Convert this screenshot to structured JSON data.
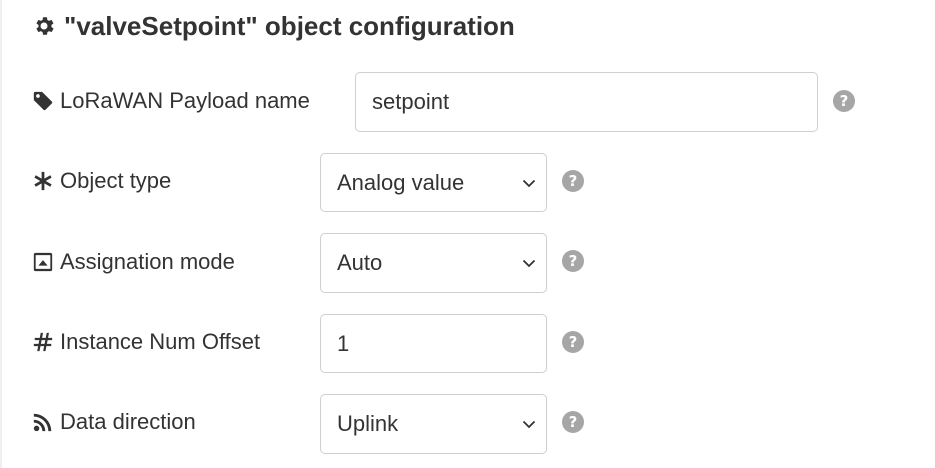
{
  "title": "\"valveSetpoint\" object configuration",
  "fields": {
    "payload_name": {
      "label": "LoRaWAN Payload name",
      "value": "setpoint",
      "icon": "tag-icon"
    },
    "object_type": {
      "label": "Object type",
      "value": "Analog value",
      "icon": "asterisk-icon"
    },
    "assignation_mode": {
      "label": "Assignation mode",
      "value": "Auto",
      "icon": "caret-square-up-icon"
    },
    "instance_offset": {
      "label": "Instance Num Offset",
      "value": "1",
      "icon": "hashtag-icon"
    },
    "data_direction": {
      "label": "Data direction",
      "value": "Uplink",
      "icon": "rss-icon"
    }
  },
  "help_glyph": "?",
  "colors": {
    "text": "#333333",
    "border": "#cfcfcf",
    "help": "#a6a6a6"
  }
}
